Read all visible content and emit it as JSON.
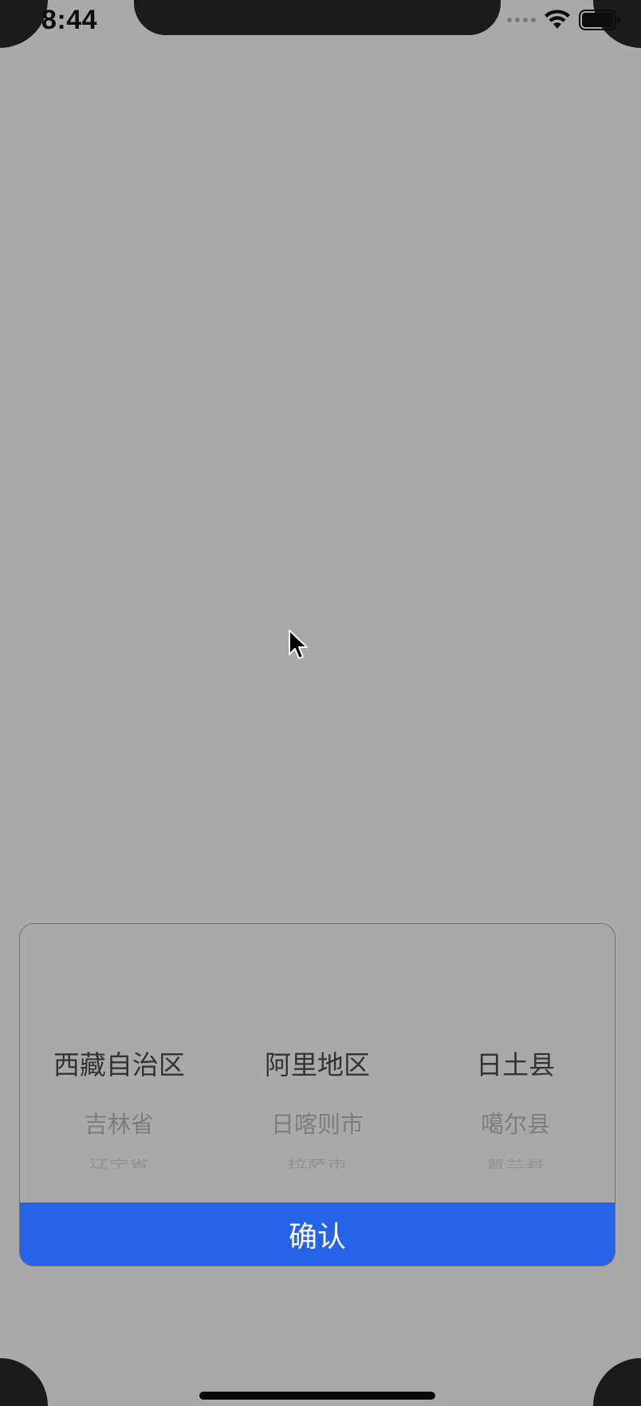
{
  "status_bar": {
    "time": "8:44"
  },
  "picker": {
    "columns": [
      {
        "selected": "西藏自治区",
        "next": "吉林省",
        "next2": "辽宁省"
      },
      {
        "selected": "阿里地区",
        "next": "日喀则市",
        "next2": "拉萨市"
      },
      {
        "selected": "日土县",
        "next": "噶尔县",
        "next2": "普兰县"
      }
    ],
    "confirm_label": "确认"
  },
  "colors": {
    "accent": "#2563e8",
    "overlay_background": "#a9a9a9"
  }
}
